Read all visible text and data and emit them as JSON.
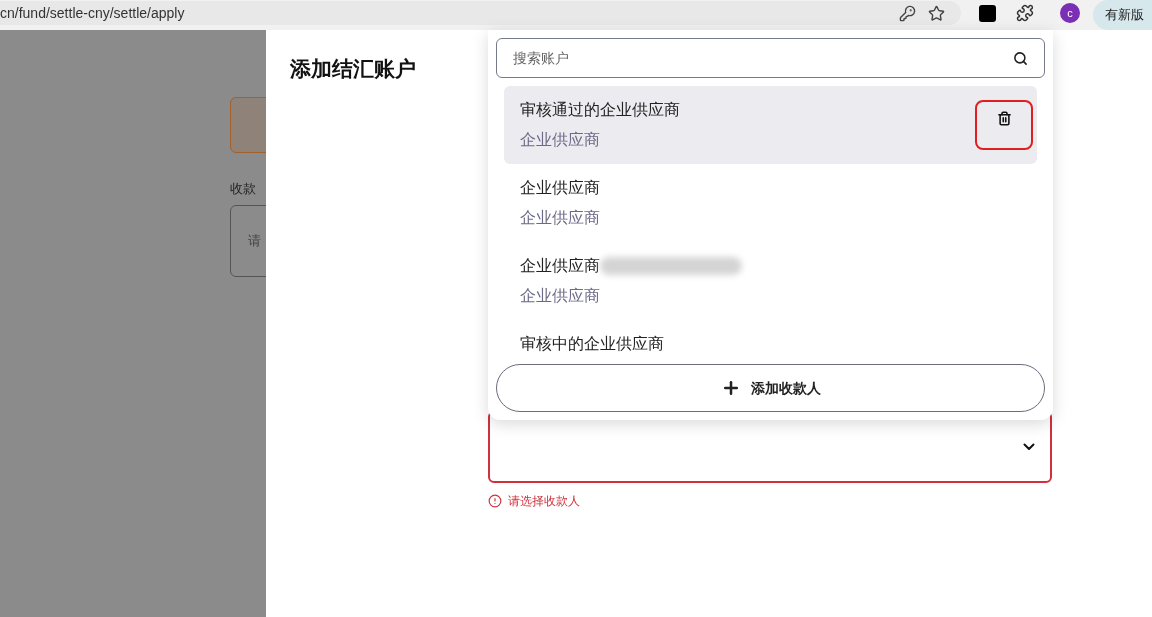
{
  "browser": {
    "url": "cn/fund/settle-cny/settle/apply",
    "avatar": "c",
    "update_pill": "有新版"
  },
  "background_page": {
    "label": "收款",
    "input_placeholder": "请"
  },
  "panel": {
    "title": "添加结汇账户"
  },
  "dropdown": {
    "search": {
      "placeholder": "搜索账户"
    },
    "items": [
      {
        "name": "审核通过的企业供应商",
        "type": "企业供应商",
        "selected": true,
        "masked": false
      },
      {
        "name": "企业供应商",
        "type": "企业供应商",
        "selected": false,
        "masked": false
      },
      {
        "name": "企业供应商",
        "type": "企业供应商",
        "selected": false,
        "masked": true
      },
      {
        "name": "审核中的企业供应商",
        "selected": false,
        "masked": false
      }
    ],
    "add_button": "添加收款人"
  },
  "payee_select": {
    "invalid": true,
    "error": "请选择收款人"
  }
}
